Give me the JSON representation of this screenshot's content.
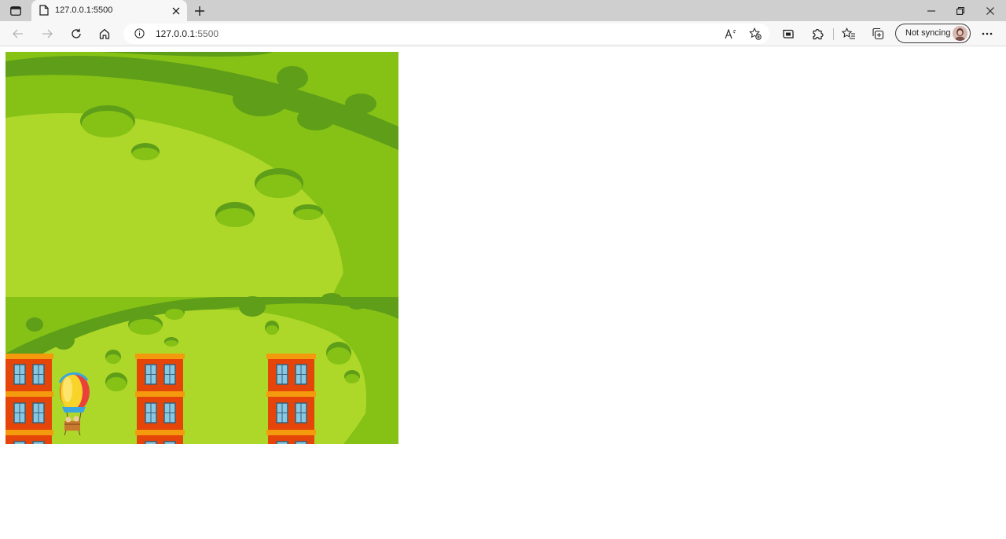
{
  "browser": {
    "tab": {
      "title": "127.0.0.1:5500",
      "favicon": "page-icon"
    },
    "address": {
      "host": "127.0.0.1",
      "port": ":5500"
    },
    "profile": {
      "label": "Not syncing"
    },
    "icons": {
      "tab_actions": "tab-actions-icon",
      "close_tab": "close-icon",
      "new_tab": "plus-icon",
      "back": "back-arrow-icon",
      "forward": "forward-arrow-icon",
      "refresh": "refresh-icon",
      "home": "home-icon",
      "site_info": "info-icon",
      "read_aloud": "read-aloud-icon",
      "add_favorite": "star-add-icon",
      "browser_essentials": "essentials-icon",
      "extensions": "puzzle-icon",
      "favorites": "favorites-icon",
      "collections": "collections-icon",
      "more": "more-icon"
    }
  },
  "game": {
    "colors": {
      "sky_dark": "#5f9e18",
      "ground_mid": "#86c216",
      "ground_light": "#aed829",
      "building": "#e6450a",
      "building_band": "#f49a0d",
      "window": "#86c7e3",
      "balloon_yellow": "#f8d42a",
      "balloon_red": "#e8433b"
    }
  }
}
